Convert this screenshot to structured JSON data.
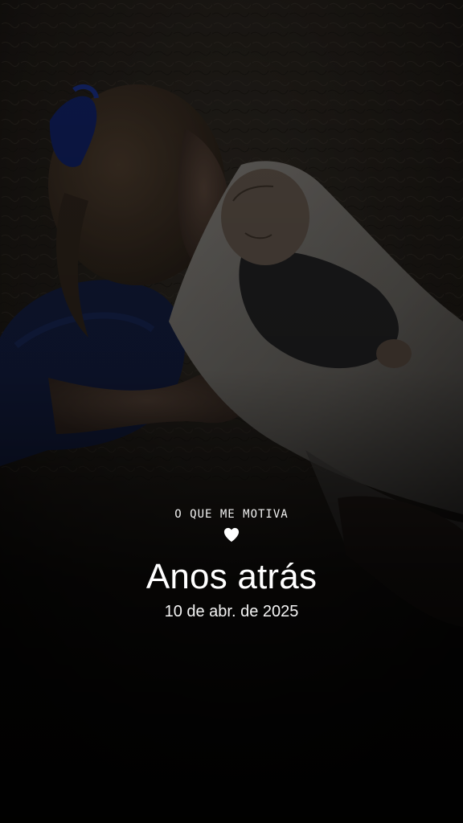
{
  "memory": {
    "caption": "O QUE ME MOTIVA",
    "caption_icon": "heart-icon",
    "title": "Anos atrás",
    "date": "10 de abr. de 2025"
  },
  "colors": {
    "text": "#ffffff",
    "shirt_blue": "#1c2f6a",
    "blanket": "#cfcac2"
  }
}
